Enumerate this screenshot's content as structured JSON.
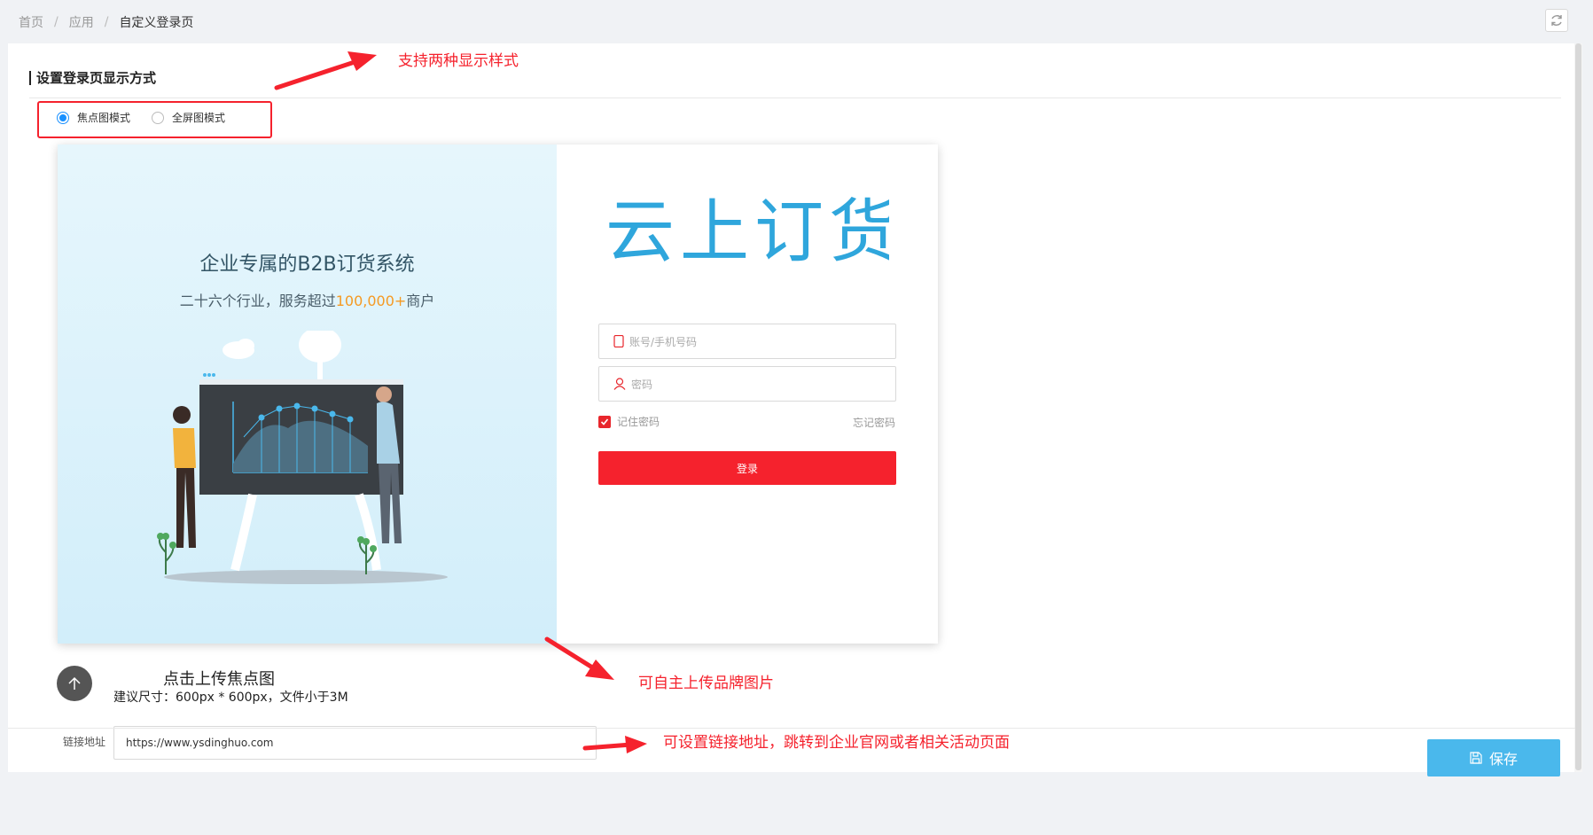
{
  "breadcrumb": {
    "items": [
      "首页",
      "应用"
    ],
    "separator": "/",
    "current": "自定义登录页"
  },
  "section": {
    "title": "设置登录页显示方式"
  },
  "display_mode": {
    "options": [
      "焦点图模式",
      "全屏图模式"
    ],
    "selected": "焦点图模式"
  },
  "preview": {
    "title": "企业专属的B2B订货系统",
    "subtitle_prefix": "二十六个行业，服务超过",
    "subtitle_highlight": "100,000+",
    "subtitle_suffix": "商户",
    "logo_text": "云上订货",
    "account_placeholder": "账号/手机号码",
    "password_placeholder": "密码",
    "remember_label": "记住密码",
    "forgot_label": "忘记密码",
    "login_label": "登录"
  },
  "upload": {
    "title": "点击上传焦点图",
    "hint": "建议尺寸：600px * 600px，文件小于3M"
  },
  "link": {
    "label": "链接地址",
    "value": "https://www.ysdinghuo.com"
  },
  "footer": {
    "save_label": "保存"
  },
  "annotations": {
    "styles": "支持两种显示样式",
    "brand": "可自主上传品牌图片",
    "link": "可设置链接地址，跳转到企业官网或者相关活动页面"
  },
  "colors": {
    "accent_blue": "#4ab8ec",
    "login_red": "#f5222d",
    "annotation_red": "#f5222d",
    "highlight_orange": "#f59a23"
  },
  "icons": {
    "refresh": "refresh-icon",
    "upload": "arrow-up-icon",
    "save": "save-icon",
    "phone": "phone-icon",
    "user": "user-icon"
  }
}
